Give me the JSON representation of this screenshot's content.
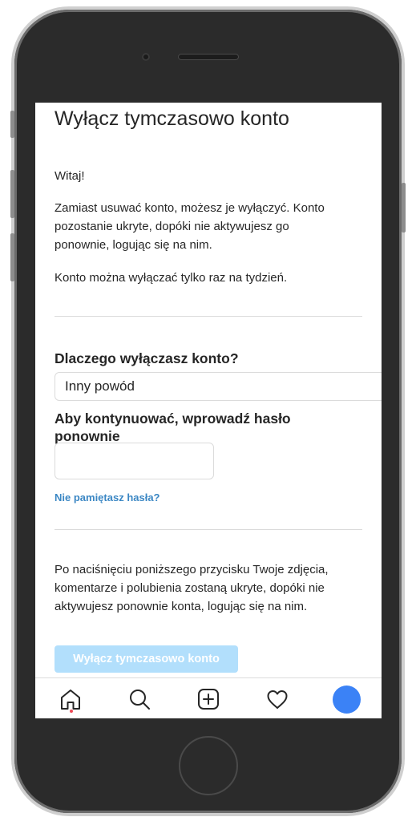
{
  "page": {
    "title": "Wyłącz tymczasowo konto",
    "greeting": "Witaj!",
    "intro_line1": "Zamiast usuwać konto, możesz je wyłączyć. Konto",
    "intro_line2": "pozostanie ukryte, dopóki nie aktywujesz go",
    "intro_line3": "ponownie, logując się na nim.",
    "weekly_limit": "Konto można wyłączać tylko raz na tydzień.",
    "reason_label": "Dlaczego wyłączasz konto?",
    "reason_value": "Inny powód",
    "password_label_line1": "Aby kontynuować, wprowadź hasło",
    "password_label_line2": "ponownie",
    "password_value": "",
    "forgot_link": "Nie pamiętasz hasła?",
    "notice_line1": "Po naciśnięciu poniższego przycisku Twoje zdjęcia,",
    "notice_line2": "komentarze i polubienia zostaną ukryte, dopóki nie",
    "notice_line3": "aktywujesz ponownie konta, logując się na nim.",
    "submit_label": "Wyłącz tymczasowo konto"
  },
  "tabbar": {
    "items": [
      "home-icon",
      "search-icon",
      "new-post-icon",
      "activity-heart-icon",
      "profile-avatar"
    ],
    "active": "home-icon",
    "notification_dot_color": "#ed4956",
    "avatar_color": "#3b82f6"
  },
  "colors": {
    "link": "#3b87c4",
    "button_disabled": "#b2dffc",
    "text": "#262626",
    "border": "#dbdbdb"
  }
}
